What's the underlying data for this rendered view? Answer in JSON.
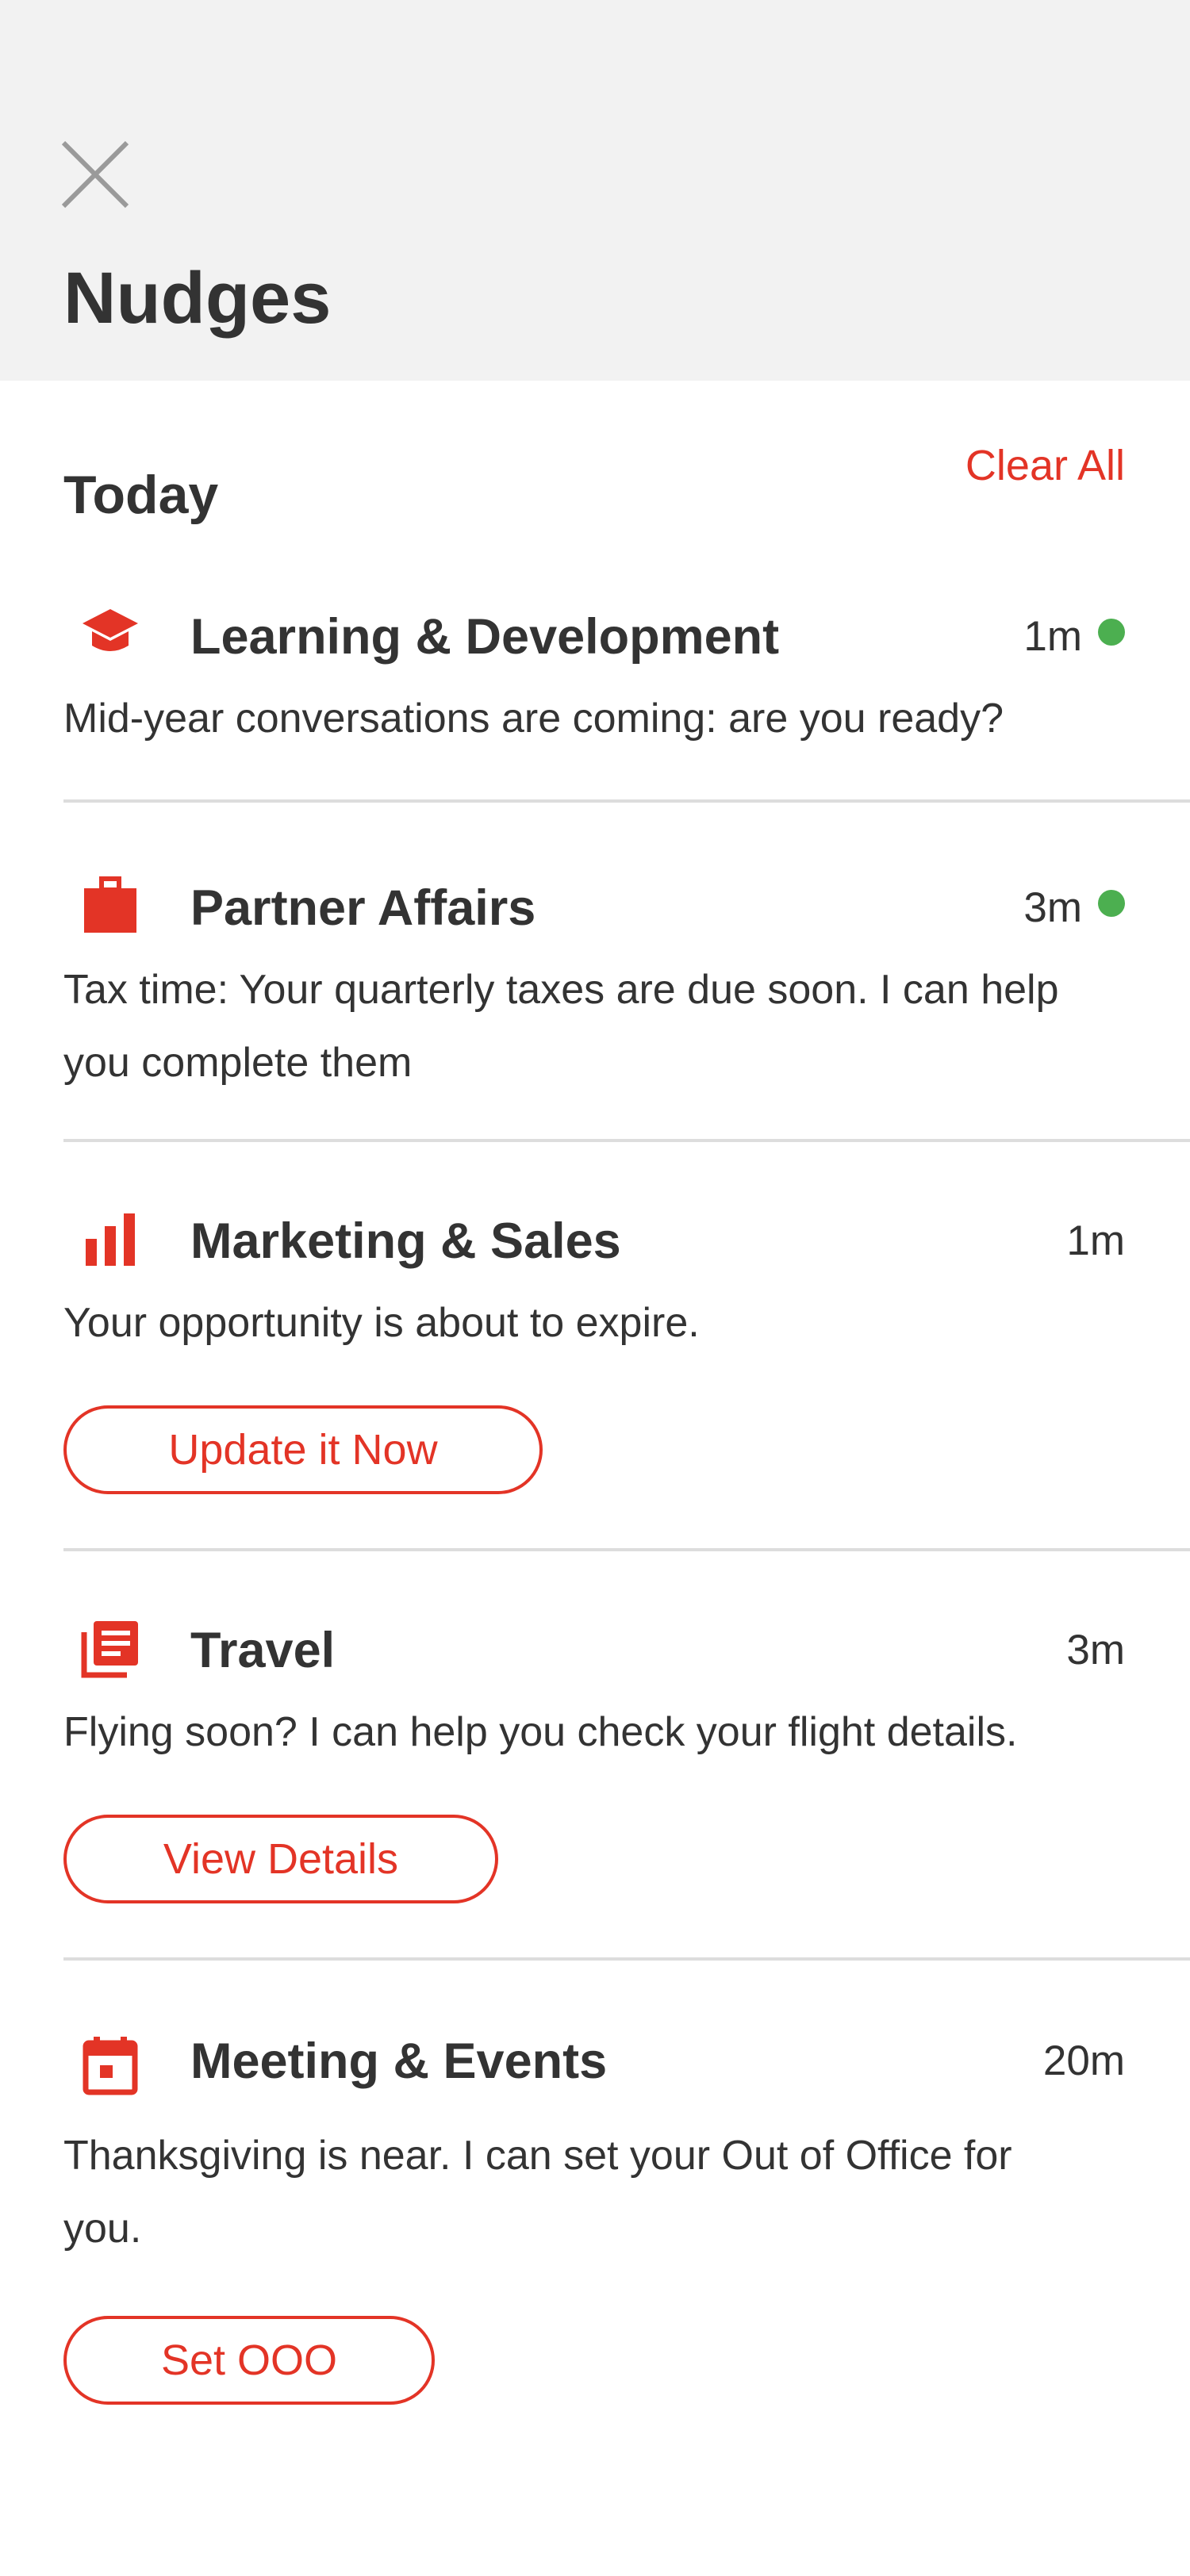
{
  "header": {
    "title": "Nudges",
    "close_icon": "close-icon"
  },
  "section": {
    "label": "Today",
    "clear_all": "Clear All"
  },
  "colors": {
    "accent": "#e33426",
    "unread_dot": "#4caf50",
    "header_bg": "#f2f2f2"
  },
  "nudges": [
    {
      "category": "Learning & Development",
      "icon": "graduation-cap-icon",
      "time": "1m",
      "unread": true,
      "message": "Mid-year conversations are coming: are you ready?"
    },
    {
      "category": "Partner Affairs",
      "icon": "briefcase-icon",
      "time": "3m",
      "unread": true,
      "message": "Tax time: Your quarterly taxes are due soon. I can help you complete them"
    },
    {
      "category": "Marketing & Sales",
      "icon": "bar-chart-icon",
      "time": "1m",
      "unread": false,
      "message": "Your opportunity is about to expire.",
      "action": "Update it Now"
    },
    {
      "category": "Travel",
      "icon": "document-stack-icon",
      "time": "3m",
      "unread": false,
      "message": "Flying soon? I can help you check your flight details.",
      "action": "View Details"
    },
    {
      "category": "Meeting & Events",
      "icon": "calendar-icon",
      "time": "20m",
      "unread": false,
      "message": "Thanksgiving is near. I can set your Out of Office for you.",
      "action": "Set OOO"
    }
  ]
}
